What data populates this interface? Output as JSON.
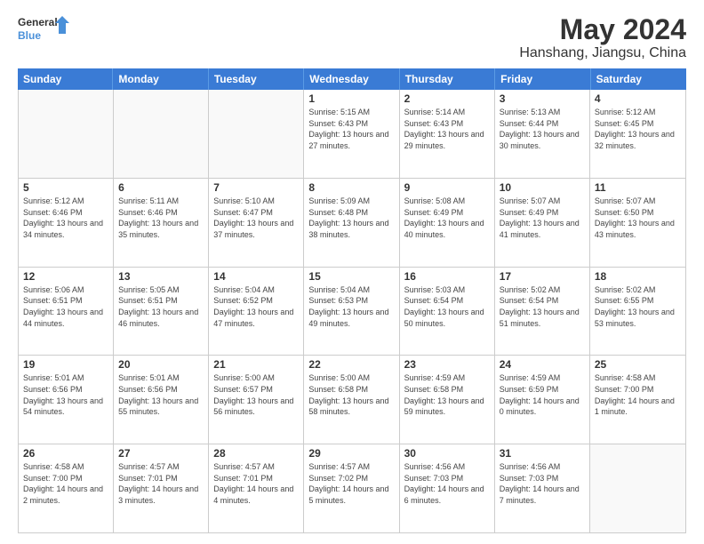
{
  "logo": {
    "line1": "General",
    "line2": "Blue"
  },
  "title": "May 2024",
  "subtitle": "Hanshang, Jiangsu, China",
  "days_of_week": [
    "Sunday",
    "Monday",
    "Tuesday",
    "Wednesday",
    "Thursday",
    "Friday",
    "Saturday"
  ],
  "weeks": [
    [
      {
        "day": "",
        "info": ""
      },
      {
        "day": "",
        "info": ""
      },
      {
        "day": "",
        "info": ""
      },
      {
        "day": "1",
        "info": "Sunrise: 5:15 AM\nSunset: 6:43 PM\nDaylight: 13 hours and 27 minutes."
      },
      {
        "day": "2",
        "info": "Sunrise: 5:14 AM\nSunset: 6:43 PM\nDaylight: 13 hours and 29 minutes."
      },
      {
        "day": "3",
        "info": "Sunrise: 5:13 AM\nSunset: 6:44 PM\nDaylight: 13 hours and 30 minutes."
      },
      {
        "day": "4",
        "info": "Sunrise: 5:12 AM\nSunset: 6:45 PM\nDaylight: 13 hours and 32 minutes."
      }
    ],
    [
      {
        "day": "5",
        "info": "Sunrise: 5:12 AM\nSunset: 6:46 PM\nDaylight: 13 hours and 34 minutes."
      },
      {
        "day": "6",
        "info": "Sunrise: 5:11 AM\nSunset: 6:46 PM\nDaylight: 13 hours and 35 minutes."
      },
      {
        "day": "7",
        "info": "Sunrise: 5:10 AM\nSunset: 6:47 PM\nDaylight: 13 hours and 37 minutes."
      },
      {
        "day": "8",
        "info": "Sunrise: 5:09 AM\nSunset: 6:48 PM\nDaylight: 13 hours and 38 minutes."
      },
      {
        "day": "9",
        "info": "Sunrise: 5:08 AM\nSunset: 6:49 PM\nDaylight: 13 hours and 40 minutes."
      },
      {
        "day": "10",
        "info": "Sunrise: 5:07 AM\nSunset: 6:49 PM\nDaylight: 13 hours and 41 minutes."
      },
      {
        "day": "11",
        "info": "Sunrise: 5:07 AM\nSunset: 6:50 PM\nDaylight: 13 hours and 43 minutes."
      }
    ],
    [
      {
        "day": "12",
        "info": "Sunrise: 5:06 AM\nSunset: 6:51 PM\nDaylight: 13 hours and 44 minutes."
      },
      {
        "day": "13",
        "info": "Sunrise: 5:05 AM\nSunset: 6:51 PM\nDaylight: 13 hours and 46 minutes."
      },
      {
        "day": "14",
        "info": "Sunrise: 5:04 AM\nSunset: 6:52 PM\nDaylight: 13 hours and 47 minutes."
      },
      {
        "day": "15",
        "info": "Sunrise: 5:04 AM\nSunset: 6:53 PM\nDaylight: 13 hours and 49 minutes."
      },
      {
        "day": "16",
        "info": "Sunrise: 5:03 AM\nSunset: 6:54 PM\nDaylight: 13 hours and 50 minutes."
      },
      {
        "day": "17",
        "info": "Sunrise: 5:02 AM\nSunset: 6:54 PM\nDaylight: 13 hours and 51 minutes."
      },
      {
        "day": "18",
        "info": "Sunrise: 5:02 AM\nSunset: 6:55 PM\nDaylight: 13 hours and 53 minutes."
      }
    ],
    [
      {
        "day": "19",
        "info": "Sunrise: 5:01 AM\nSunset: 6:56 PM\nDaylight: 13 hours and 54 minutes."
      },
      {
        "day": "20",
        "info": "Sunrise: 5:01 AM\nSunset: 6:56 PM\nDaylight: 13 hours and 55 minutes."
      },
      {
        "day": "21",
        "info": "Sunrise: 5:00 AM\nSunset: 6:57 PM\nDaylight: 13 hours and 56 minutes."
      },
      {
        "day": "22",
        "info": "Sunrise: 5:00 AM\nSunset: 6:58 PM\nDaylight: 13 hours and 58 minutes."
      },
      {
        "day": "23",
        "info": "Sunrise: 4:59 AM\nSunset: 6:58 PM\nDaylight: 13 hours and 59 minutes."
      },
      {
        "day": "24",
        "info": "Sunrise: 4:59 AM\nSunset: 6:59 PM\nDaylight: 14 hours and 0 minutes."
      },
      {
        "day": "25",
        "info": "Sunrise: 4:58 AM\nSunset: 7:00 PM\nDaylight: 14 hours and 1 minute."
      }
    ],
    [
      {
        "day": "26",
        "info": "Sunrise: 4:58 AM\nSunset: 7:00 PM\nDaylight: 14 hours and 2 minutes."
      },
      {
        "day": "27",
        "info": "Sunrise: 4:57 AM\nSunset: 7:01 PM\nDaylight: 14 hours and 3 minutes."
      },
      {
        "day": "28",
        "info": "Sunrise: 4:57 AM\nSunset: 7:01 PM\nDaylight: 14 hours and 4 minutes."
      },
      {
        "day": "29",
        "info": "Sunrise: 4:57 AM\nSunset: 7:02 PM\nDaylight: 14 hours and 5 minutes."
      },
      {
        "day": "30",
        "info": "Sunrise: 4:56 AM\nSunset: 7:03 PM\nDaylight: 14 hours and 6 minutes."
      },
      {
        "day": "31",
        "info": "Sunrise: 4:56 AM\nSunset: 7:03 PM\nDaylight: 14 hours and 7 minutes."
      },
      {
        "day": "",
        "info": ""
      }
    ]
  ]
}
